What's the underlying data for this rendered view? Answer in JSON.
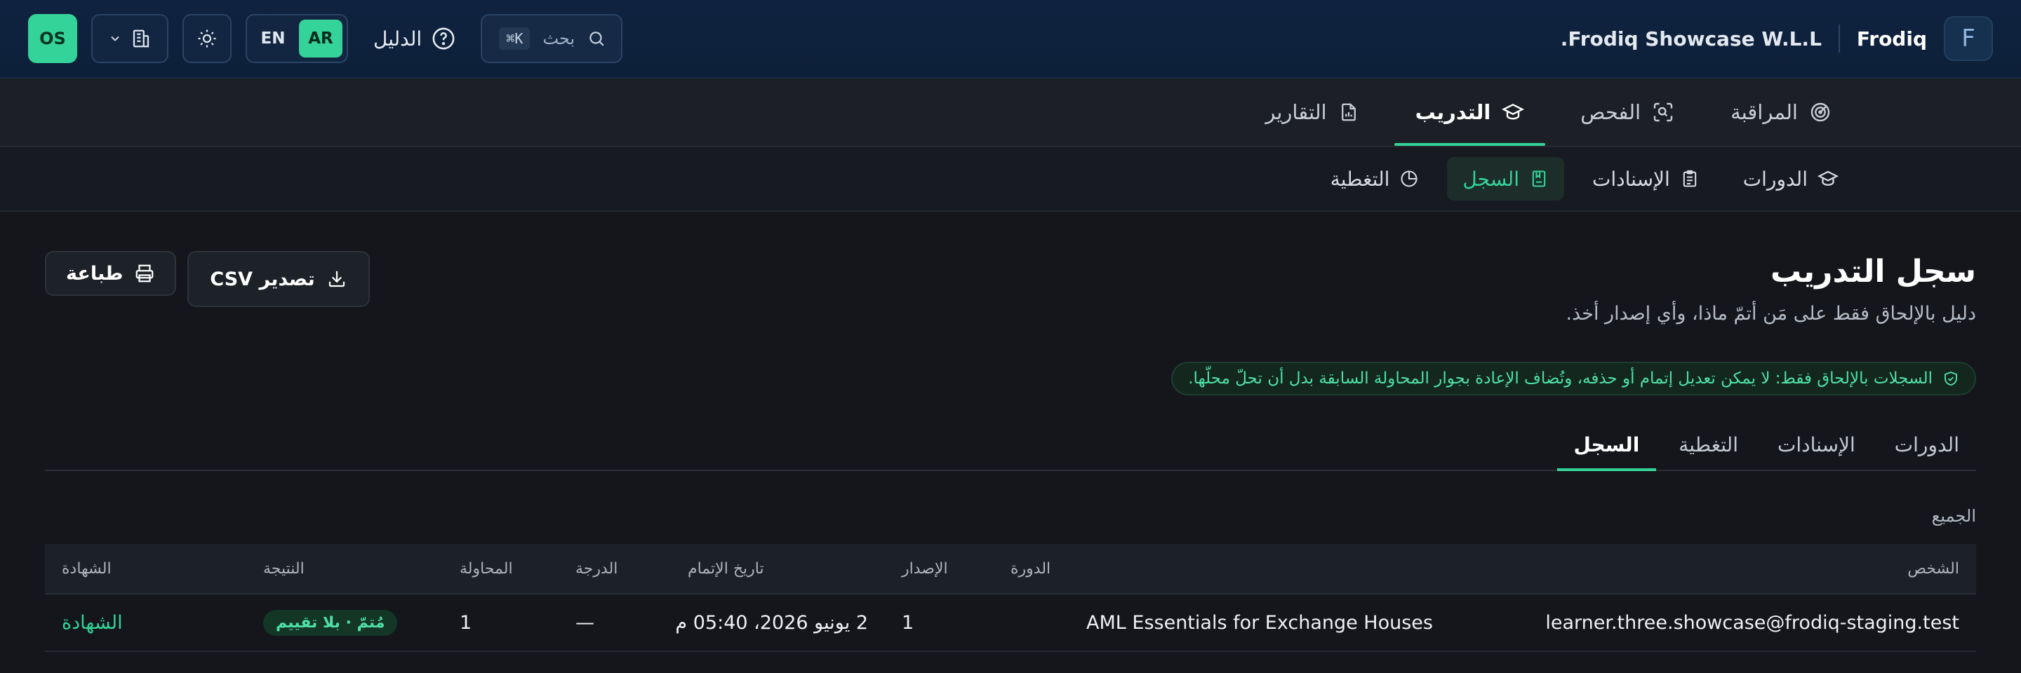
{
  "header": {
    "logo_glyph": "F",
    "brand": "Frodiq",
    "org": "Frodiq Showcase W.L.L.",
    "search": {
      "label": "بحث",
      "shortcut": "⌘K"
    },
    "guide_label": "الدليل",
    "lang": {
      "ar": "AR",
      "en": "EN",
      "active": "AR"
    },
    "avatar": "OS"
  },
  "main_nav": [
    {
      "label": "المراقبة",
      "icon": "radar-icon",
      "active": false
    },
    {
      "label": "الفحص",
      "icon": "scan-icon",
      "active": false
    },
    {
      "label": "التدريب",
      "icon": "graduation-cap-icon",
      "active": true
    },
    {
      "label": "التقارير",
      "icon": "report-icon",
      "active": false
    }
  ],
  "sub_nav": [
    {
      "label": "الدورات",
      "icon": "graduation-cap-icon",
      "active": false
    },
    {
      "label": "الإسنادات",
      "icon": "clipboard-icon",
      "active": false
    },
    {
      "label": "السجل",
      "icon": "record-book-icon",
      "active": true
    },
    {
      "label": "التغطية",
      "icon": "pie-chart-icon",
      "active": false
    }
  ],
  "page": {
    "title": "سجل التدريب",
    "subtitle": "دليل بالإلحاق فقط على مَن أتمّ ماذا، وأي إصدار أخذ.",
    "export_label": "تصدير CSV",
    "print_label": "طباعة",
    "notice": "السجلات بالإلحاق فقط: لا يمكن تعديل إتمام أو حذفه، وتُضاف الإعادة بجوار المحاولة السابقة بدل أن تحلّ محلّها."
  },
  "tabs": [
    {
      "label": "الدورات",
      "active": false
    },
    {
      "label": "الإسنادات",
      "active": false
    },
    {
      "label": "التغطية",
      "active": false
    },
    {
      "label": "السجل",
      "active": true
    }
  ],
  "filter_label": "الجميع",
  "table": {
    "headers": {
      "person": "الشخص",
      "course": "الدورة",
      "version": "الإصدار",
      "completed": "تاريخ الإتمام",
      "score": "الدرجة",
      "attempt": "المحاولة",
      "result": "النتيجة",
      "certificate": "الشهادة"
    },
    "rows": [
      {
        "person": "learner.three.showcase@frodiq-staging.test",
        "course": "AML Essentials for Exchange Houses",
        "version": "1",
        "completed": "2 يونيو 2026، 05:40 م",
        "score": "—",
        "attempt": "1",
        "result": "مُتمّ · بلا تقييم",
        "certificate": "الشهادة"
      }
    ]
  },
  "colors": {
    "accent": "#34d399",
    "topbar": "#0f2340",
    "background": "#14161b"
  }
}
